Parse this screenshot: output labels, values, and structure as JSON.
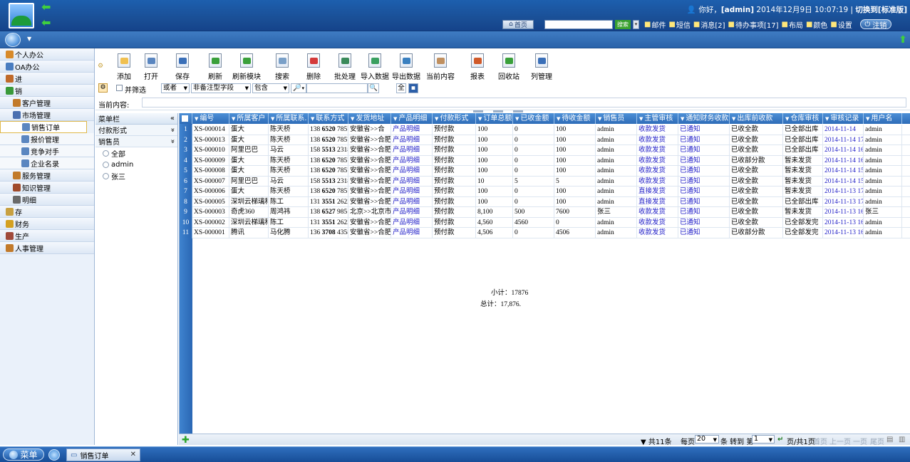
{
  "header": {
    "greeting_prefix": "你好，",
    "user": "[admin]",
    "datetime": "2014年12月9日  10:07:19",
    "switch_label": "切换到[标准版]",
    "home_label": "首页",
    "search_label": "搜索",
    "links": [
      {
        "label": "邮件",
        "icon": "mail-icon"
      },
      {
        "label": "短信",
        "icon": "sms-icon"
      },
      {
        "label": "消息[2]",
        "icon": "speaker-icon"
      },
      {
        "label": "待办事项[17]",
        "icon": "todo-icon"
      },
      {
        "label": "布局",
        "icon": "layout-icon"
      },
      {
        "label": "颜色",
        "icon": "color-icon"
      },
      {
        "label": "设置",
        "icon": "gear-icon"
      }
    ],
    "logout_label": "注销"
  },
  "sidebar": {
    "items": [
      {
        "label": "个人办公",
        "level": 0,
        "color": "#d88a2a"
      },
      {
        "label": "OA办公",
        "level": 0,
        "color": "#4a7dc0"
      },
      {
        "label": "进",
        "level": 0,
        "color": "#c06a2a"
      },
      {
        "label": "销",
        "level": 0,
        "color": "#3a9a3a"
      },
      {
        "label": "客户管理",
        "level": 1,
        "color": "#c27a2a"
      },
      {
        "label": "市场管理",
        "level": 1,
        "color": "#4a6fb0"
      },
      {
        "label": "销售订单",
        "level": 2,
        "color": "#5a86c0",
        "active": true
      },
      {
        "label": "报价管理",
        "level": 2,
        "color": "#5a86c0"
      },
      {
        "label": "竞争对手",
        "level": 2,
        "color": "#5a86c0"
      },
      {
        "label": "企业名录",
        "level": 2,
        "color": "#5a86c0"
      },
      {
        "label": "服务管理",
        "level": 1,
        "color": "#c27a2a"
      },
      {
        "label": "知识管理",
        "level": 1,
        "color": "#a04a2a"
      },
      {
        "label": "明细",
        "level": 1,
        "color": "#6a6a6a"
      },
      {
        "label": "存",
        "level": 0,
        "color": "#c8a040"
      },
      {
        "label": "财务",
        "level": 0,
        "color": "#d4a020"
      },
      {
        "label": "生产",
        "level": 0,
        "color": "#a04a3a"
      },
      {
        "label": "人事管理",
        "level": 0,
        "color": "#c27a2a"
      }
    ]
  },
  "toolbar": {
    "buttons": [
      {
        "label": "添加",
        "icon": "add-icon"
      },
      {
        "label": "打开",
        "icon": "open-icon"
      },
      {
        "label": "保存",
        "icon": "save-icon"
      },
      {
        "label": "刷新",
        "icon": "refresh-icon"
      },
      {
        "label": "刷新模块",
        "icon": "refresh-module-icon"
      },
      {
        "label": "搜索",
        "icon": "search-icon"
      },
      {
        "label": "删除",
        "icon": "delete-icon"
      },
      {
        "label": "批处理",
        "icon": "batch-icon"
      },
      {
        "label": "导入数据",
        "icon": "import-icon"
      },
      {
        "label": "导出数据",
        "icon": "export-icon"
      },
      {
        "label": "当前内容",
        "icon": "current-content-icon"
      },
      {
        "label": "报表",
        "icon": "report-icon"
      },
      {
        "label": "回收站",
        "icon": "recycle-bin-icon"
      },
      {
        "label": "列管理",
        "icon": "column-manage-icon"
      }
    ]
  },
  "filter": {
    "combined_filter_label": "并筛选",
    "logic": "或者",
    "field": "非备注型字段",
    "operator": "包含",
    "value": ""
  },
  "current_content_label": "当前内容:",
  "tree": {
    "title": "菜单栏",
    "sections": [
      "付款形式",
      "销售员"
    ],
    "options": [
      "全部",
      "admin",
      "张三"
    ]
  },
  "grid": {
    "columns": [
      "编号",
      "所属客户",
      "所属联系.",
      "联系方式",
      "发货地址",
      "产品明细",
      "付款形式",
      "订单总额",
      "已收金额",
      "待收金额",
      "销售员",
      "主管审核",
      "通知财务收款",
      "出库前收款",
      "仓库审核",
      "审核记录",
      "用户名"
    ],
    "rows": [
      [
        "XS-000014",
        "蛋大",
        "陈天桥",
        [
          "138",
          "6520",
          "7857"
        ],
        "安徽省>>合",
        "产品明细",
        "预付款",
        "100",
        "0",
        "100",
        "admin",
        "收款发货",
        "已通知",
        "已收全款",
        "已全部出库",
        "2014-11-14",
        "admin"
      ],
      [
        "XS-000013",
        "蛋大",
        "陈天桥",
        [
          "138",
          "6520",
          "7857"
        ],
        "安徽省>>合肥",
        "产品明细",
        "预付款",
        "100",
        "0",
        "100",
        "admin",
        "收款发货",
        "已通知",
        "已收全款",
        "已全部出库",
        "2014-11-14 17:",
        "admin"
      ],
      [
        "XS-000010",
        "阿里巴巴",
        "马云",
        [
          "158",
          "5513",
          "2318"
        ],
        "安徽省>>合肥",
        "产品明细",
        "预付款",
        "100",
        "0",
        "100",
        "admin",
        "收款发货",
        "已通知",
        "已收全款",
        "已全部出库",
        "2014-11-14 16:",
        "admin"
      ],
      [
        "XS-000009",
        "蛋大",
        "陈天桥",
        [
          "138",
          "6520",
          "7857"
        ],
        "安徽省>>合肥",
        "产品明细",
        "预付款",
        "100",
        "0",
        "100",
        "admin",
        "收款发货",
        "已通知",
        "已收部分款",
        "暂未发货",
        "2014-11-14 16:",
        "admin"
      ],
      [
        "XS-000008",
        "蛋大",
        "陈天桥",
        [
          "138",
          "6520",
          "7857"
        ],
        "安徽省>>合肥",
        "产品明细",
        "预付款",
        "100",
        "0",
        "100",
        "admin",
        "收款发货",
        "已通知",
        "已收全款",
        "暂未发货",
        "2014-11-14 15:",
        "admin"
      ],
      [
        "XS-000007",
        "阿里巴巴",
        "马云",
        [
          "158",
          "5513",
          "2318"
        ],
        "安徽省>>合肥",
        "产品明细",
        "预付款",
        "10",
        "5",
        "5",
        "admin",
        "收款发货",
        "已通知",
        "已收全款",
        "暂未发货",
        "2014-11-14 15:",
        "admin"
      ],
      [
        "XS-000006",
        "蛋大",
        "陈天桥",
        [
          "138",
          "6520",
          "7857"
        ],
        "安徽省>>合肥",
        "产品明细",
        "预付款",
        "100",
        "0",
        "100",
        "admin",
        "直接发货",
        "已通知",
        "已收全款",
        "暂未发货",
        "2014-11-13 17:",
        "admin"
      ],
      [
        "XS-000005",
        "深圳云梯璃科技",
        "陈工",
        [
          "131",
          "3551",
          "2622"
        ],
        "安徽省>>合肥",
        "产品明细",
        "预付款",
        "100",
        "0",
        "100",
        "admin",
        "直接发货",
        "已通知",
        "已收全款",
        "已全部出库",
        "2014-11-13 17:",
        "admin"
      ],
      [
        "XS-000003",
        "奇虎360",
        "周鸿祎",
        [
          "138",
          "6527",
          "9851"
        ],
        "北京>>北京市",
        "产品明细",
        "预付款",
        "8,100",
        "500",
        "7600",
        "张三",
        "收款发货",
        "已通知",
        "已收全款",
        "暂未发货",
        "2014-11-13 16:",
        "张三"
      ],
      [
        "XS-000002",
        "深圳云梯璃科技",
        "陈工",
        [
          "131",
          "3551",
          "2622"
        ],
        "安徽省>>合肥",
        "产品明细",
        "预付款",
        "4,560",
        "4560",
        "0",
        "admin",
        "收款发货",
        "已通知",
        "已收全款",
        "已全部发完",
        "2014-11-13 16:",
        "admin"
      ],
      [
        "XS-000001",
        "腾讯",
        "马化腾",
        [
          "136",
          "3708",
          "4358"
        ],
        "安徽省>>合肥",
        "产品明细",
        "预付款",
        "4,506",
        "0",
        "4506",
        "admin",
        "收款发货",
        "已通知",
        "已收部分款",
        "已全部发完",
        "2014-11-13 16:",
        "admin"
      ]
    ],
    "subtotal": "小计：17876",
    "total": "总计：17,876."
  },
  "pager": {
    "total": "共11条",
    "per_page_label": "每页",
    "per_page": "20",
    "goto_label": "条 转到 第",
    "page": "1",
    "page_info": "页/共1页",
    "first": "首页",
    "prev": "上一页",
    "next": "一页",
    "last": "尾页"
  },
  "taskbar": {
    "menu_label": "菜单",
    "tab_label": "销售订单"
  }
}
